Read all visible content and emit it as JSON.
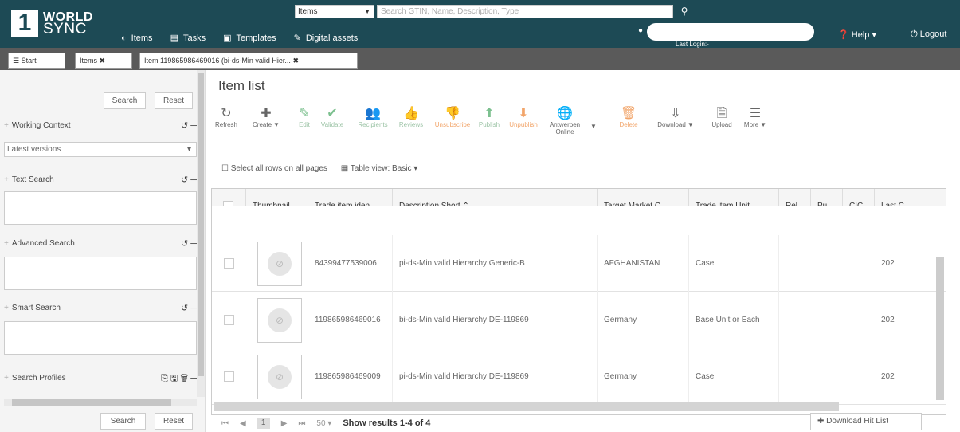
{
  "header": {
    "logo_line1": "WORLD",
    "logo_line2": "SYNC",
    "nav": [
      "Items",
      "Tasks",
      "Templates",
      "Digital assets"
    ],
    "search_select": "Items",
    "search_placeholder": "Search GTIN, Name, Description, Type",
    "last_login": "Last Login:-",
    "help": "Help",
    "logout": "Logout"
  },
  "tabs": [
    "Start",
    "Items",
    "Item 119865986469016 (bi-ds-Min valid Hier..."
  ],
  "sidebar": {
    "search": "Search",
    "reset": "Reset",
    "working_context": "Working Context",
    "working_value": "Latest versions",
    "text_search": "Text Search",
    "advanced_search": "Advanced Search",
    "smart_search": "Smart Search",
    "search_profiles": "Search Profiles"
  },
  "main": {
    "title": "Item list",
    "toolbar": [
      "Refresh",
      "Create",
      "Edit",
      "Validate",
      "Recipients",
      "Reviews",
      "Unsubscribe",
      "Publish",
      "Unpublish",
      "Antwerpen Online",
      "Delete",
      "Download",
      "Upload",
      "More"
    ],
    "select_all": "Select all rows on all pages",
    "table_view": "Table view: Basic",
    "columns": [
      "Thumbnail...",
      "Trade item iden...",
      "Description Short",
      "Target Market C...",
      "Trade item Unit ...",
      "Rel...",
      "Pu...",
      "CIC...",
      "Last C"
    ],
    "rows": [
      {
        "gtin": "84399477539006",
        "desc": "pi-ds-Min valid Hierarchy Generic-B",
        "market": "AFGHANISTAN",
        "unit": "Case",
        "last": "202"
      },
      {
        "gtin": "119865986469016",
        "desc": "bi-ds-Min valid Hierarchy DE-119869",
        "market": "Germany",
        "unit": "Base Unit or Each",
        "last": "202"
      },
      {
        "gtin": "119865986469009",
        "desc": "pi-ds-Min valid Hierarchy DE-119869",
        "market": "Germany",
        "unit": "Case",
        "last": "202"
      }
    ],
    "pager": {
      "page": "1",
      "per_page": "50",
      "results": "Show results 1-4 of 4"
    },
    "download_hit_list": "Download Hit List"
  }
}
